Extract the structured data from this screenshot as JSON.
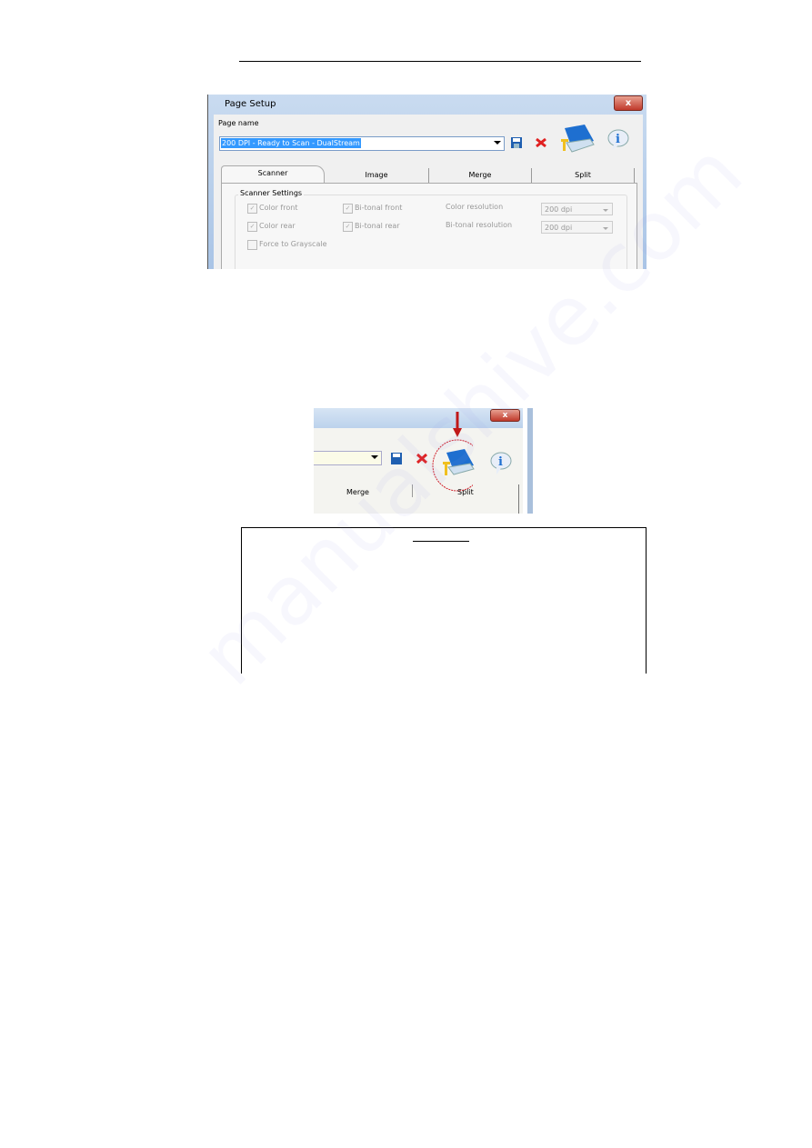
{
  "dialog": {
    "title": "Page Setup",
    "close_label": "x",
    "page_name_label": "Page name",
    "page_name_value": "200 DPI - Ready to Scan - DualStream",
    "tabs": [
      "Scanner",
      "Image",
      "Merge",
      "Split"
    ],
    "active_tab": "Scanner",
    "group_title": "Scanner Settings",
    "checkboxes": [
      {
        "label": "Color front",
        "checked": true
      },
      {
        "label": "Color rear",
        "checked": true
      },
      {
        "label": "Force to Grayscale",
        "checked": false
      },
      {
        "label": "Bi-tonal front",
        "checked": true
      },
      {
        "label": "Bi-tonal rear",
        "checked": true
      }
    ],
    "color_resolution_label": "Color resolution",
    "color_resolution_value": "200 dpi",
    "bitonal_resolution_label": "Bi-tonal resolution",
    "bitonal_resolution_value": "200 dpi"
  },
  "detail": {
    "close_label": "x",
    "tabs": [
      "Merge",
      "Split"
    ],
    "highlight_color": "#d0202a"
  },
  "watermark": "manualshive.com"
}
